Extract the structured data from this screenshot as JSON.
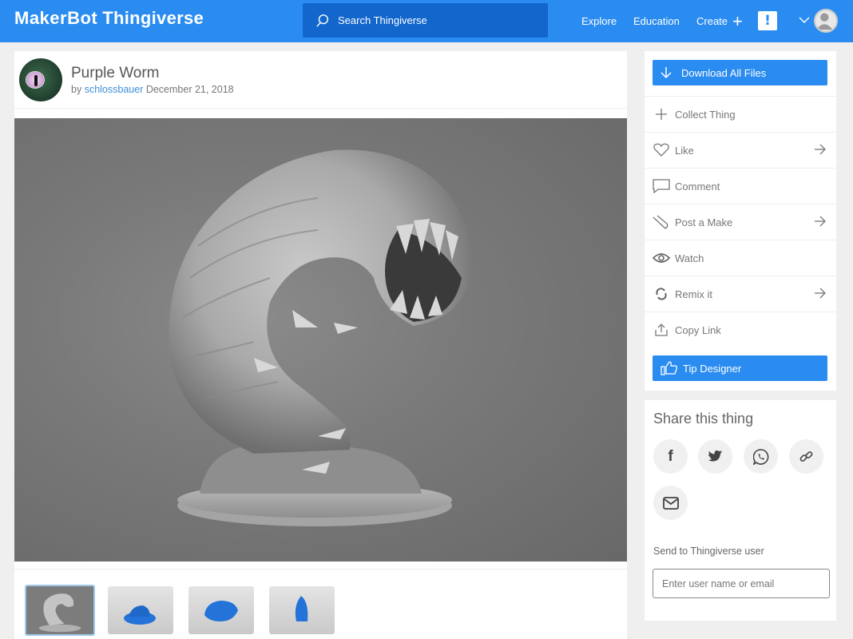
{
  "header": {
    "logo_part1": "MakerBot",
    "logo_part2": "Thingiverse",
    "search_placeholder": "Search Thingiverse",
    "nav": [
      "Explore",
      "Education",
      "Create"
    ],
    "create_plus": "+",
    "alert_label": "!",
    "brand_color": "#2a8cf0"
  },
  "thing": {
    "title": "Purple Worm",
    "by_prefix": "by",
    "author": "schlossbauer",
    "date": "December 21, 2018",
    "thumbnails": [
      {
        "label": "grey-render",
        "active": true
      },
      {
        "label": "blue-render-1",
        "active": false
      },
      {
        "label": "blue-render-2",
        "active": false
      },
      {
        "label": "blue-render-3",
        "active": false
      }
    ]
  },
  "sidebar": {
    "download_label": "Download All Files",
    "actions": [
      {
        "label": "Collect Thing",
        "icon": "plus-icon",
        "arrow": false
      },
      {
        "label": "Like",
        "icon": "heart-icon",
        "arrow": true
      },
      {
        "label": "Comment",
        "icon": "comment-icon",
        "arrow": false
      },
      {
        "label": "Post a Make",
        "icon": "make-icon",
        "arrow": true
      },
      {
        "label": "Watch",
        "icon": "eye-icon",
        "arrow": false
      },
      {
        "label": "Remix it",
        "icon": "remix-icon",
        "arrow": true
      },
      {
        "label": "Copy Link",
        "icon": "share-icon",
        "arrow": false
      }
    ],
    "tip_label": "Tip Designer"
  },
  "share": {
    "title": "Share this thing",
    "icons": [
      "facebook-icon",
      "twitter-icon",
      "whatsapp-icon",
      "link-icon",
      "email-icon"
    ],
    "send_label": "Send to Thingiverse user",
    "input_placeholder": "Enter user name or email"
  }
}
